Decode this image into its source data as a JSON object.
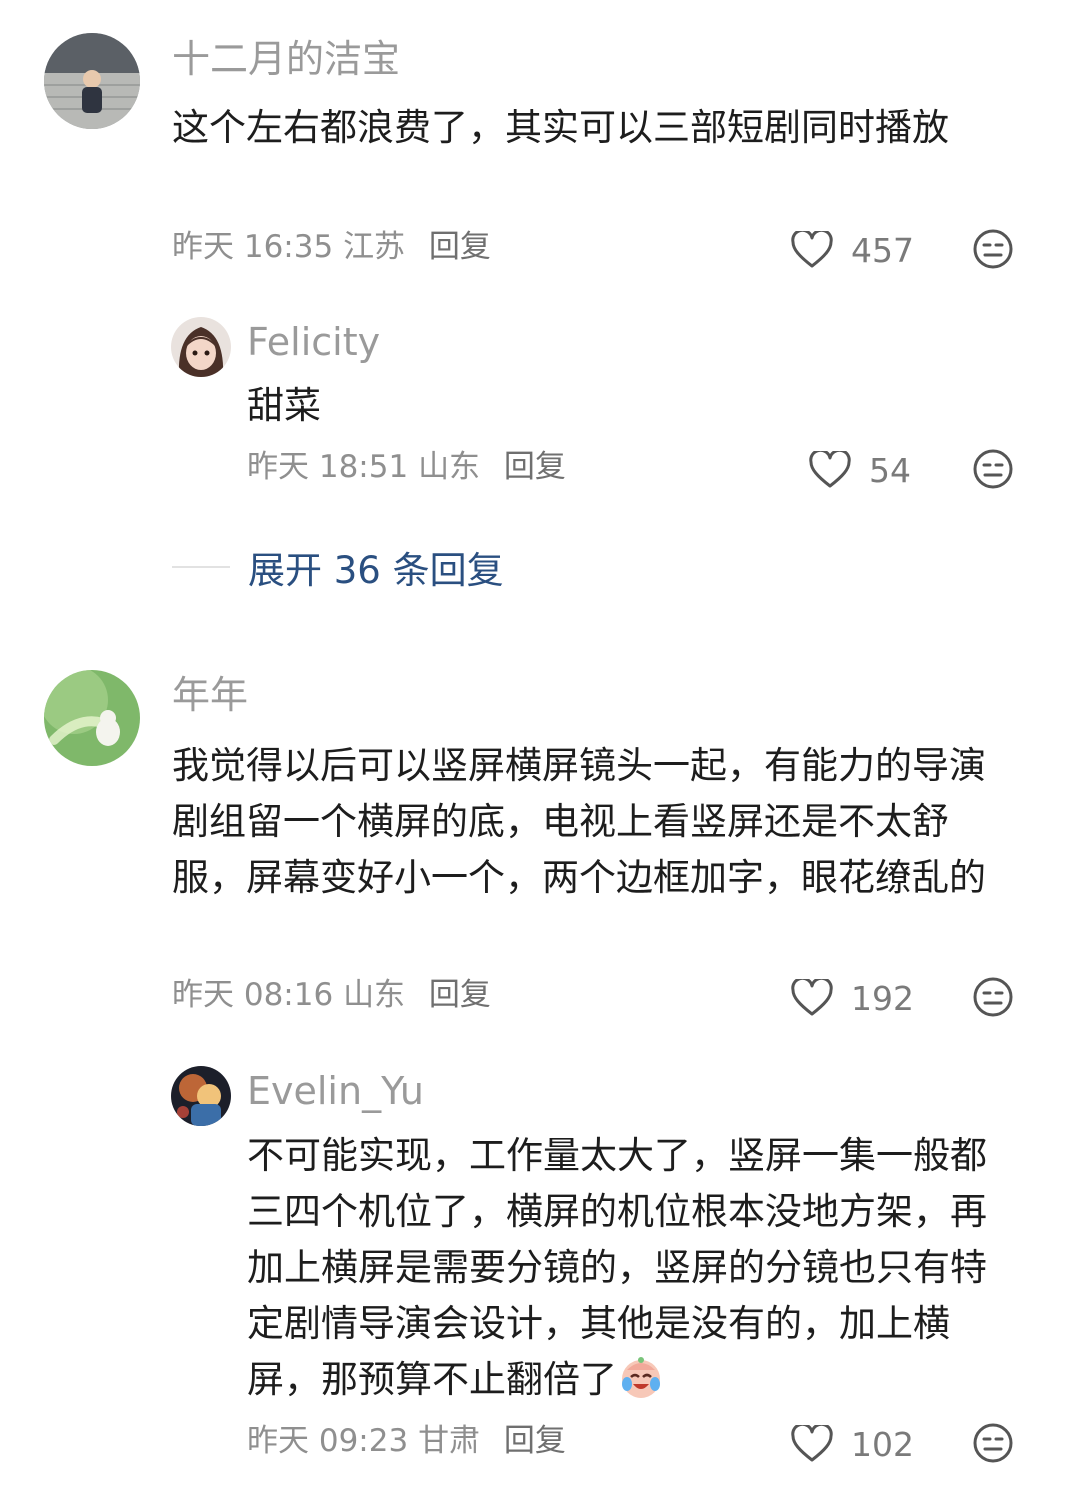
{
  "comments": [
    {
      "username": "十二月的洁宝",
      "content": "这个左右都浪费了，其实可以三部短剧同时播放",
      "time": "昨天 16:35",
      "location": "江苏",
      "reply_label": "回复",
      "likes": "457",
      "replies": [
        {
          "username": "Felicity",
          "content": "甜菜",
          "time": "昨天 18:51",
          "location": "山东",
          "reply_label": "回复",
          "likes": "54"
        }
      ],
      "expand_label": "展开 36 条回复"
    },
    {
      "username": "年年",
      "content": "我觉得以后可以竖屏横屏镜头一起，有能力的导演剧组留一个横屏的底，电视上看竖屏还是不太舒服，屏幕变好小一个，两个边框加字，眼花缭乱的",
      "time": "昨天 08:16",
      "location": "山东",
      "reply_label": "回复",
      "likes": "192",
      "replies": [
        {
          "username": "Evelin_Yu",
          "content": "不可能实现，工作量太大了，竖屏一集一般都三四个机位了，横屏的机位根本没地方架，再加上横屏是需要分镜的，竖屏的分镜也只有特定剧情导演会设计，其他是没有的，加上横屏，那预算不止翻倍了",
          "time": "昨天 09:23",
          "location": "甘肃",
          "reply_label": "回复",
          "likes": "102"
        }
      ]
    }
  ],
  "icons": {
    "like": "heart-outline-icon",
    "reaction": "neutral-face-icon",
    "inline_emoji": "crying-laughing-face-icon"
  },
  "colors": {
    "link": "#2a4f80",
    "secondary_text": "#8f8f8f"
  }
}
